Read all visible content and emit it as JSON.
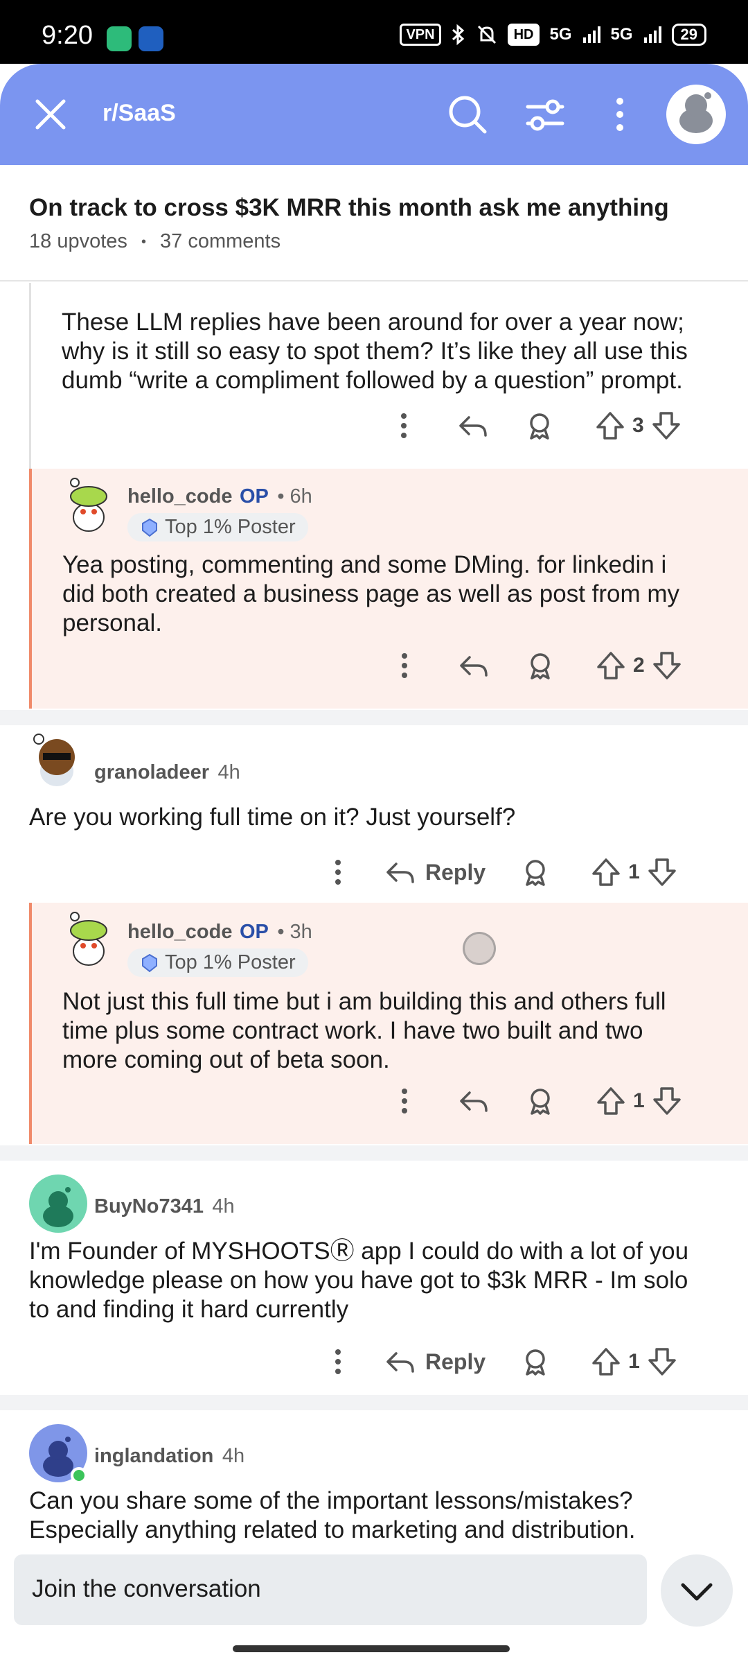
{
  "status_bar": {
    "time": "9:20",
    "vpn": "VPN",
    "hd": "HD",
    "net1": "5G",
    "net2": "5G",
    "battery": "29"
  },
  "app_bar": {
    "subreddit": "r/SaaS"
  },
  "post": {
    "title": "On track to cross $3K MRR this month ask me anything",
    "upvotes": "18 upvotes",
    "comments": "37 comments",
    "dot": "•"
  },
  "comments": [
    {
      "body_line1": "These LLM replies have been around for over a year now;",
      "body_line2": "why is it still so easy to spot them? It’s like they all use this",
      "body_line3": "dumb “write a compliment followed by a question” prompt.",
      "votes": "3"
    },
    {
      "user": "hello_code",
      "op": "OP",
      "time": "• 6h",
      "flair": "Top 1% Poster",
      "body_line1": "Yea posting, commenting and some DMing. for linkedin i",
      "body_line2": "did both created a business page as well as post from my",
      "body_line3": "personal.",
      "votes": "2"
    },
    {
      "user": "granoladeer",
      "time": "4h",
      "body_line1": "Are you working full time on it? Just yourself?",
      "reply": "Reply",
      "votes": "1"
    },
    {
      "user": "hello_code",
      "op": "OP",
      "time": "• 3h",
      "flair": "Top 1% Poster",
      "body_line1": "Not just this full time but i am building this and others full",
      "body_line2": "time plus some contract work. I have two built and two",
      "body_line3": "more coming out of beta soon.",
      "votes": "1"
    },
    {
      "user": "BuyNo7341",
      "time": "4h",
      "body_line1": "I'm Founder of MYSHOOTSⓇ app I could do with a lot of you",
      "body_line2": "knowledge please on how you have got to $3k MRR - Im solo",
      "body_line3": "to and finding it hard currently",
      "reply": "Reply",
      "votes": "1"
    },
    {
      "user": "inglandation",
      "time": "4h",
      "body_line1": "Can you share some of the important lessons/mistakes?",
      "body_line2": "Especially anything related to marketing and distribution."
    }
  ],
  "composer": {
    "placeholder": "Join the conversation"
  },
  "colors": {
    "app_bar": "#7b95f0",
    "op_highlight": "#fdf0ec",
    "op_border": "#f08a6a",
    "op_label": "#2a4fa8"
  }
}
